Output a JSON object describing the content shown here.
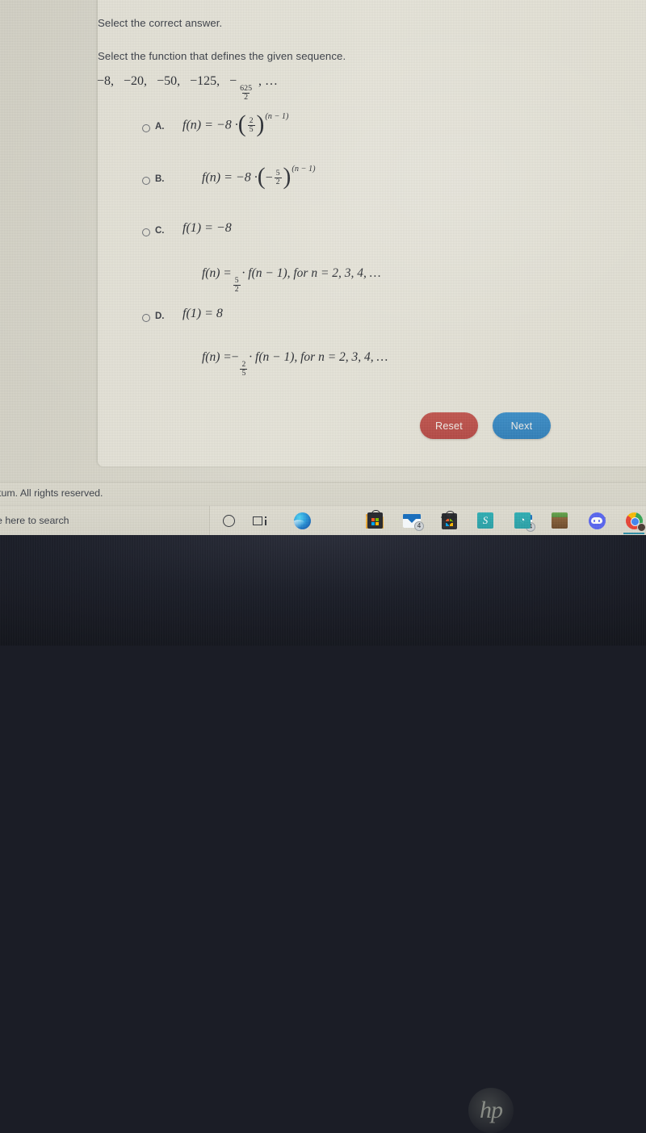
{
  "question": {
    "instruction": "Select the correct answer.",
    "prompt": "Select the function that defines the given sequence.",
    "sequence": {
      "terms": [
        "−8,",
        "−20,",
        "−50,",
        "−125,"
      ],
      "last_term_sign": "−",
      "last_term_numerator": "625",
      "last_term_denominator": "2",
      "ellipsis": ", …"
    }
  },
  "options": [
    {
      "letter": "A.",
      "selected": false,
      "line1": {
        "lhs": "f(n)  =  −8 ·",
        "frac_num": "2",
        "frac_den": "5",
        "exponent": "(n − 1)",
        "neg_in_paren": ""
      }
    },
    {
      "letter": "B.",
      "selected": false,
      "line1": {
        "lhs": "f(n)  =  −8 ·",
        "frac_num": "5",
        "frac_den": "2",
        "exponent": "(n − 1)",
        "neg_in_paren": "−"
      }
    },
    {
      "letter": "C.",
      "selected": false,
      "line1": {
        "text": "f(1) = −8"
      },
      "line2": {
        "lhs": "f(n) =",
        "frac_num": "5",
        "frac_den": "2",
        "rhs": "· f(n − 1),  for  n  =  2, 3, 4, …",
        "neg_before_frac": ""
      }
    },
    {
      "letter": "D.",
      "selected": false,
      "line1": {
        "text": "f(1) = 8"
      },
      "line2": {
        "lhs": "f(n) =",
        "frac_num": "2",
        "frac_den": "5",
        "rhs": "· f(n − 1),  for  n  =  2, 3, 4, …",
        "neg_before_frac": "−"
      }
    }
  ],
  "buttons": {
    "reset_label": "Reset",
    "reset_color": "#bc4f49",
    "next_label": "Next",
    "next_color": "#3685c1"
  },
  "footer": {
    "copyright": "tum. All rights reserved."
  },
  "taskbar": {
    "search_placeholder": "e here to search",
    "icons": [
      {
        "name": "cortana-icon",
        "label": "Cortana"
      },
      {
        "name": "task-view-icon",
        "label": "Task View"
      },
      {
        "name": "microsoft-edge-icon",
        "label": "Microsoft Edge"
      },
      {
        "name": "file-explorer-icon",
        "label": "File Explorer"
      },
      {
        "name": "microsoft-store-icon",
        "label": "Microsoft Store"
      },
      {
        "name": "mail-icon",
        "label": "Mail",
        "badge": "4"
      },
      {
        "name": "dropbox-icon",
        "label": "Dropbox"
      },
      {
        "name": "teal-app-icon",
        "label": "S"
      },
      {
        "name": "teal-leaf-app-icon",
        "label": "◔"
      },
      {
        "name": "minecraft-icon",
        "label": "Minecraft"
      },
      {
        "name": "discord-icon",
        "label": "Discord"
      },
      {
        "name": "google-chrome-icon",
        "label": "Google Chrome"
      }
    ]
  },
  "device": {
    "brand_logo": "hp"
  }
}
